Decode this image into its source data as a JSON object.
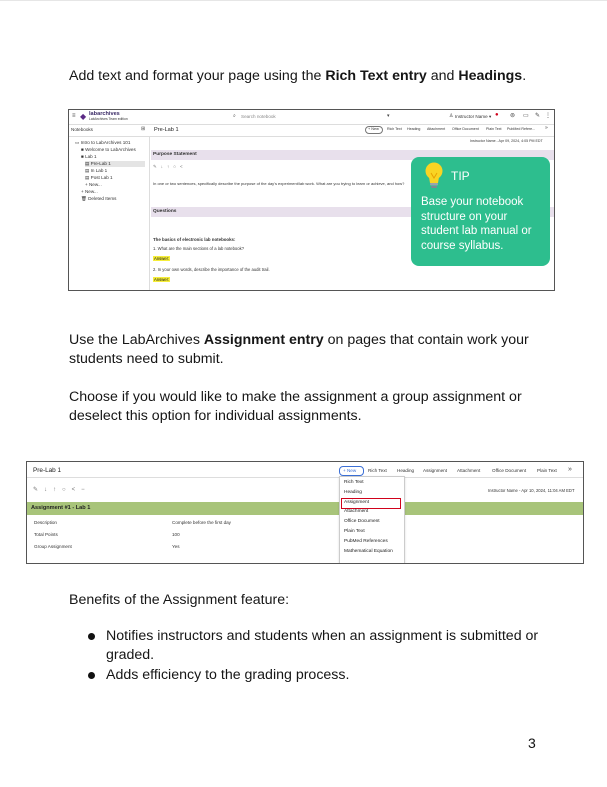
{
  "intro": {
    "prefix": "Add text and format your page using the ",
    "bold1": "Rich Text entry",
    "mid": " and ",
    "bold2": "Headings",
    "suffix": "."
  },
  "shot1": {
    "logo_text": "labarchives",
    "logo_sub": "LabArchives Team edition",
    "search_placeholder": "Search notebook",
    "user_menu": "Instructor Name ▾",
    "notebook_label": "Notebooks",
    "page_title": "Pre-Lab 1",
    "new_button": "+ New",
    "entry_types": [
      "Rich Text",
      "Heading",
      "Attachment",
      "Office Document",
      "Plain Text",
      "PubMed Refere..."
    ],
    "tree": [
      "Intro to LabArchives 101",
      "Welcome to LabArchives",
      "Lab 1",
      "Pre-Lab 1",
      "In Lab 1",
      "Post Lab 1",
      "+ New...",
      "+ New...",
      "Deleted Items"
    ],
    "timestamp": "Instructor Name - Apr 09, 2024, 4:05 PM EDT",
    "section1": "Purpose Statement",
    "section1_text": "In one or two sentences, specifically describe the purpose of the day's experiment/lab work. What are you trying to learn or achieve, and how?",
    "section2": "Questions",
    "q_heading": "The basics of electronic lab notebooks:",
    "q1": "1. What are the main sections of a lab notebook?",
    "q2": "2. In your own words, describe the importance of the audit trail.",
    "answer_label": "Answer:"
  },
  "tip": {
    "title": "TIP",
    "text": "Base your notebook structure on your student lab manual or course syllabus."
  },
  "para2": {
    "prefix": "Use the LabArchives ",
    "bold": "Assignment entry",
    "suffix": " on pages that contain work your students need to submit."
  },
  "para3": "Choose if you would like to make the assignment a group assignment or deselect this option for individual assignments.",
  "shot2": {
    "page_title": "Pre-Lab 1",
    "new_button": "+ New",
    "entry_types": [
      "Rich Text",
      "Heading",
      "Assignment",
      "Attachment",
      "Office Document",
      "Plain Text"
    ],
    "timestamp": "Instructor Name - Apr 10, 2024, 11:04 AM EDT",
    "assignment_title": "Assignment #1 - Lab 1",
    "rows": [
      {
        "label": "Description",
        "value": "Complete before the first day"
      },
      {
        "label": "Total Points",
        "value": "100"
      },
      {
        "label": "Group Assignment",
        "value": "Yes"
      }
    ],
    "menu_items": [
      "Rich Text",
      "Heading",
      "Assignment",
      "Attachment",
      "Office Document",
      "Plain Text",
      "PubMed References",
      "Mathematical Equation"
    ],
    "highlighted_item": "Assignment"
  },
  "benefits_title": "Benefits of the Assignment feature:",
  "benefits": [
    "Notifies instructors and students when an assignment is submitted or graded.",
    "Adds efficiency to the grading process."
  ],
  "page_number": "3",
  "colors": {
    "tip_green": "#2dbe8e",
    "assignment_green": "#a8c47a",
    "highlight_red": "#d0021b",
    "section_purple": "#e8e0ec"
  }
}
